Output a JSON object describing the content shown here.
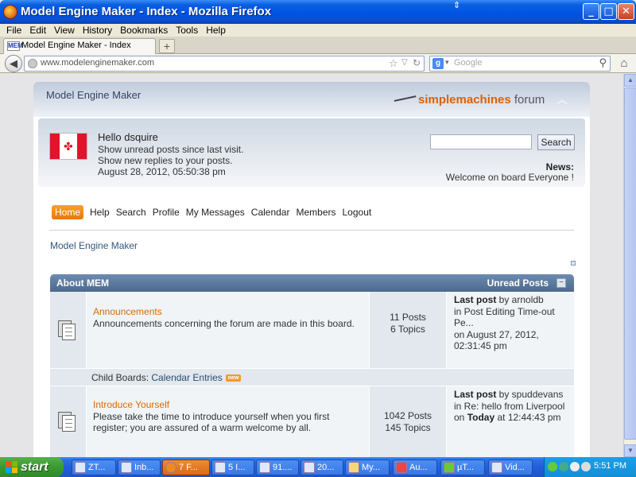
{
  "window": {
    "title": "Model Engine Maker - Index - Mozilla Firefox"
  },
  "menubar": [
    "File",
    "Edit",
    "View",
    "History",
    "Bookmarks",
    "Tools",
    "Help"
  ],
  "tab": {
    "label": "Model Engine Maker - Index",
    "favicon": "MEM"
  },
  "nav": {
    "url": "www.modelenginemaker.com",
    "search_placeholder": "Google"
  },
  "forum": {
    "title": "Model Engine Maker",
    "logo_a": "simplemachines",
    "logo_b": " forum",
    "greeting": "Hello dsquire",
    "unread_link": "Show unread posts since last visit.",
    "replies_link": "Show new replies to your posts.",
    "datetime": "August 28, 2012, 05:50:38 pm",
    "search_button": "Search",
    "news_label": "News:",
    "news_text": "Welcome on board Everyone !",
    "menu": [
      "Home",
      "Help",
      "Search",
      "Profile",
      "My Messages",
      "Calendar",
      "Members",
      "Logout"
    ],
    "breadcrumb": "Model Engine Maker",
    "category": {
      "name": "About MEM",
      "unread": "Unread Posts"
    },
    "boards": [
      {
        "name": "Announcements",
        "desc": "Announcements concerning the forum are made in this board.",
        "posts": "11 Posts",
        "topics": "6 Topics",
        "last_label": "Last post",
        "last_by": " by arnoldb",
        "last_in": "in Post Editing Time-out Pe...",
        "last_on": "on August 27, 2012, 02:31:45 pm"
      },
      {
        "name": "Introduce Yourself",
        "desc": "Please take the time to introduce yourself when you first register; you are assured of a warm welcome by all.",
        "posts": "1042 Posts",
        "topics": "145 Topics",
        "last_label": "Last post",
        "last_by": " by spuddevans",
        "last_in": "in Re: hello from Liverpool",
        "last_on_prefix": "on ",
        "last_on_bold": "Today",
        "last_on_suffix": " at 12:44:43 pm"
      }
    ],
    "child_boards_label": "Child Boards:",
    "child_board": "Calendar Entries",
    "new_badge": "new"
  },
  "taskbar": {
    "start": "start",
    "items": [
      "ZT...",
      "Inb...",
      "7 F...",
      "5 I...",
      "91....",
      "20...",
      "My...",
      "Au...",
      "µT...",
      "Vid..."
    ],
    "clock": "5:51 PM"
  }
}
